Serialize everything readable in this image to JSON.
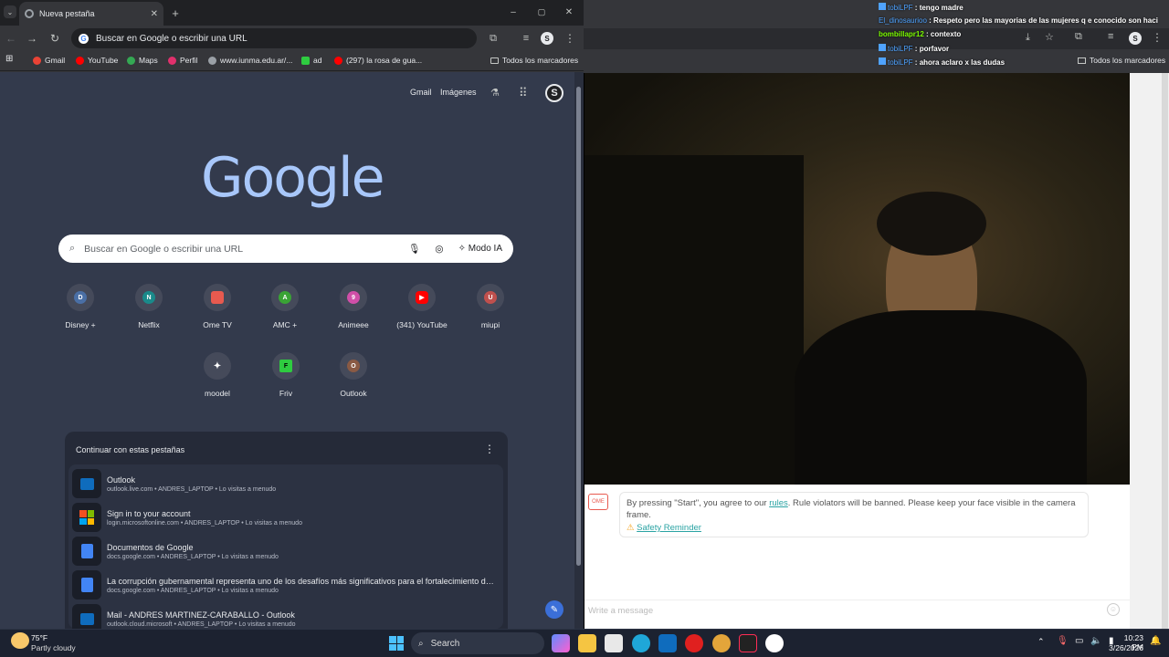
{
  "left_browser": {
    "tab_title": "Nueva pestaña",
    "omnibox_text": "Buscar en Google o escribir una URL",
    "profile_letter": "S",
    "bookmarks": [
      {
        "label": "Gmail",
        "color": "#ea4335"
      },
      {
        "label": "YouTube",
        "color": "#ff0000"
      },
      {
        "label": "Maps",
        "color": "#34a853"
      },
      {
        "label": "Perfil",
        "color": "#e1306c"
      },
      {
        "label": "www.iunma.edu.ar/...",
        "color": "#9aa0a6"
      },
      {
        "label": "ad",
        "color": "#2ecc40"
      },
      {
        "label": "(297) la rosa de gua...",
        "color": "#ff0000"
      }
    ],
    "all_bookmarks": "Todos los marcadores"
  },
  "ntp": {
    "links": {
      "gmail": "Gmail",
      "images": "Imágenes"
    },
    "logo": "Google",
    "search_placeholder": "Buscar en Google o escribir una URL",
    "ai_mode": "Modo IA",
    "shortcuts": [
      {
        "label": "Disney +",
        "letter": "D",
        "color": "#4a6fa5"
      },
      {
        "label": "Netflix",
        "letter": "N",
        "color": "#1a8a8a"
      },
      {
        "label": "Ome TV",
        "letter": "",
        "color": "#e85a4f"
      },
      {
        "label": "AMC +",
        "letter": "A",
        "color": "#3aa335"
      },
      {
        "label": "Animeee",
        "letter": "9",
        "color": "#d04fa8"
      },
      {
        "label": "(341) YouTube",
        "letter": "▶",
        "color": "#ff0000"
      },
      {
        "label": "miupi",
        "letter": "U",
        "color": "#c0504d"
      },
      {
        "label": "moodel",
        "letter": "✦",
        "color": "#454a5a"
      },
      {
        "label": "Friv",
        "letter": "F",
        "color": "#2ecc40"
      },
      {
        "label": "Outlook",
        "letter": "O",
        "color": "#8a5a44"
      }
    ],
    "continue_title": "Continuar con estas pestañas",
    "continue_items": [
      {
        "title": "Outlook",
        "sub": "outlook.live.com • ANDRES_LAPTOP • Lo visitas a menudo",
        "icon": "outlook-icon",
        "color": "#0f6cbd"
      },
      {
        "title": "Sign in to your account",
        "sub": "login.microsoftonline.com • ANDRES_LAPTOP • Lo visitas a menudo",
        "icon": "microsoft-icon",
        "color": "#f25022"
      },
      {
        "title": "Documentos de Google",
        "sub": "docs.google.com • ANDRES_LAPTOP • Lo visitas a menudo",
        "icon": "docs-icon",
        "color": "#4285f4"
      },
      {
        "title": "La corrupción gubernamental representa uno de los desafíos más significativos para el fortalecimiento de las...",
        "sub": "docs.google.com • ANDRES_LAPTOP • Lo visitas a menudo",
        "icon": "docs-icon",
        "color": "#4285f4"
      },
      {
        "title": "Mail - ANDRES MARTINEZ-CARABALLO - Outlook",
        "sub": "outlook.cloud.microsoft • ANDRES_LAPTOP • Lo visitas a menudo",
        "icon": "outlook-icon",
        "color": "#0f6cbd"
      }
    ]
  },
  "right": {
    "chat": [
      {
        "user": "tobiLPF",
        "msg": "tengo madre",
        "color": "#4fa3ff"
      },
      {
        "user": "El_dinosaurioo",
        "msg": "Respeto pero las mayorias de las mujeres q e conocido son haci",
        "color": "#4fa3ff"
      },
      {
        "user": "bombillapr12",
        "msg": "contexto",
        "color": "#7cfc00"
      },
      {
        "user": "tobiLPF",
        "msg": "porfavor",
        "color": "#4fa3ff"
      },
      {
        "user": "tobiLPF",
        "msg": "ahora aclaro x las dudas",
        "color": "#4fa3ff"
      }
    ],
    "all_bookmarks": "Todos los marcadores",
    "rules_pre": "By pressing \"Start\", you agree to our ",
    "rules_link": "rules",
    "rules_post": ". Rule violators will be banned. Please keep your face visible in the camera frame.",
    "safety": "Safety Reminder",
    "message_placeholder": "Write a message"
  },
  "taskbar": {
    "temp": "75°F",
    "weather": "Partly cloudy",
    "search": "Search",
    "time": "10:23 PM",
    "date": "3/26/2026"
  }
}
